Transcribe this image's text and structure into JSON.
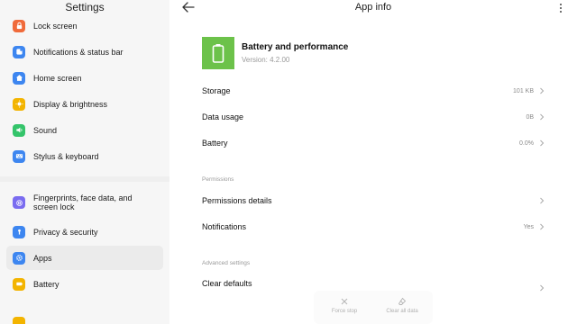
{
  "sidebar": {
    "title": "Settings",
    "items": [
      {
        "label": "Lock screen",
        "icon": "lock-icon",
        "color": "#f06a3a"
      },
      {
        "label": "Notifications & status bar",
        "icon": "notification-icon",
        "color": "#3d86f0"
      },
      {
        "label": "Home screen",
        "icon": "home-icon",
        "color": "#3d86f0"
      },
      {
        "label": "Display & brightness",
        "icon": "sun-icon",
        "color": "#f3b400"
      },
      {
        "label": "Sound",
        "icon": "sound-icon",
        "color": "#34c46a"
      },
      {
        "label": "Stylus & keyboard",
        "icon": "keyboard-icon",
        "color": "#3d86f0"
      },
      {
        "label": "Fingerprints, face data, and",
        "label2": "screen lock",
        "icon": "fingerprint-icon",
        "color": "#7a6cf0"
      },
      {
        "label": "Privacy & security",
        "icon": "privacy-icon",
        "color": "#3d86f0"
      },
      {
        "label": "Apps",
        "icon": "apps-gear-icon",
        "color": "#3d86f0"
      },
      {
        "label": "Battery",
        "icon": "battery-icon",
        "color": "#f3b400"
      }
    ]
  },
  "main": {
    "title": "App info",
    "app": {
      "name": "Battery and performance",
      "version": "Version: 4.2.00",
      "color": "#6cc24a"
    },
    "rows": {
      "storage": {
        "label": "Storage",
        "value": "101 KB"
      },
      "data_usage": {
        "label": "Data usage",
        "value": "0B"
      },
      "battery": {
        "label": "Battery",
        "value": "0.0%"
      },
      "permissions_details": {
        "label": "Permissions details",
        "value": ""
      },
      "notifications": {
        "label": "Notifications",
        "value": "Yes"
      },
      "clear_defaults": {
        "label": "Clear defaults",
        "value": ""
      }
    },
    "sections": {
      "permissions": "Permissions",
      "advanced": "Advanced settings"
    },
    "bottom": {
      "force_stop": "Force stop",
      "clear_all_data": "Clear all data"
    }
  }
}
